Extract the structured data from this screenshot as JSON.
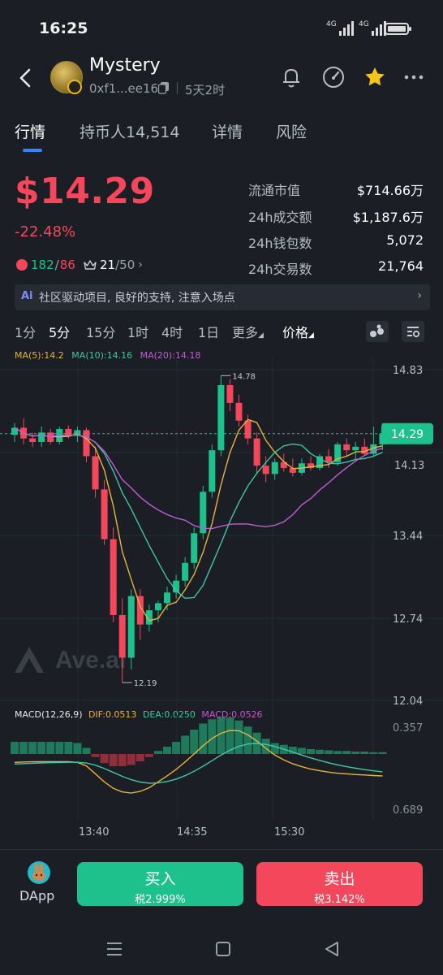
{
  "status": {
    "time": "16:25",
    "signal1": "4G",
    "signal2": "4G"
  },
  "token": {
    "name": "Mystery",
    "address": "0xf1...ee16",
    "age": "5天2时"
  },
  "tabs": [
    "行情",
    "持币人14,514",
    "详情",
    "风险"
  ],
  "price": {
    "value": "$14.29",
    "change": "-22.48%"
  },
  "badges": {
    "buy_count": "182",
    "sell_count": "86",
    "separator": "/",
    "holders_rank": "21",
    "holders_total": "/50"
  },
  "stats": [
    {
      "label": "流通市值",
      "value": "$714.66万"
    },
    {
      "label": "24h成交额",
      "value": "$1,187.6万"
    },
    {
      "label": "24h钱包数",
      "value": "5,072"
    },
    {
      "label": "24h交易数",
      "value": "21,764"
    }
  ],
  "notice": {
    "ai_label": "Ai",
    "text": "社区驱动项目, 良好的支持, 注意入场点"
  },
  "intervals": [
    "1分",
    "5分",
    "15分",
    "1时",
    "4时",
    "1日",
    "更多",
    "价格"
  ],
  "ma": {
    "ma5": "MA(5):14.2",
    "ma10": "MA(10):14.16",
    "ma20": "MA(20):14.18"
  },
  "macd": {
    "label": "MACD(12,26,9)",
    "dif": "DIF:0.0513",
    "dea": "DEA:0.0250",
    "macd": "MACD:0.0526"
  },
  "colors": {
    "up": "#1ec08c",
    "down": "#f5475c",
    "ma5": "#e8b43a",
    "ma10": "#3fc7a6",
    "ma20": "#c35ad6",
    "accent": "#3b82f6"
  },
  "chart_data": {
    "type": "candlestick",
    "y_ticks": [
      "14.83",
      "14.13",
      "13.44",
      "12.74",
      "12.04"
    ],
    "current_price": "14.29",
    "high_label": "14.78",
    "low_label": "12.19",
    "watermark": "Ave.ai",
    "macd_ticks": [
      "0.357",
      "0.689"
    ],
    "x_labels": [
      "13:40",
      "14:35",
      "15:30"
    ],
    "ylim": [
      12.04,
      14.83
    ],
    "candles": [
      {
        "o": 14.28,
        "h": 14.38,
        "l": 14.22,
        "c": 14.34
      },
      {
        "o": 14.34,
        "h": 14.42,
        "l": 14.2,
        "c": 14.25
      },
      {
        "o": 14.25,
        "h": 14.3,
        "l": 14.18,
        "c": 14.22
      },
      {
        "o": 14.22,
        "h": 14.35,
        "l": 14.18,
        "c": 14.3
      },
      {
        "o": 14.3,
        "h": 14.33,
        "l": 14.2,
        "c": 14.22
      },
      {
        "o": 14.22,
        "h": 14.35,
        "l": 14.2,
        "c": 14.33
      },
      {
        "o": 14.33,
        "h": 14.36,
        "l": 14.25,
        "c": 14.27
      },
      {
        "o": 14.27,
        "h": 14.35,
        "l": 14.22,
        "c": 14.32
      },
      {
        "o": 14.32,
        "h": 14.34,
        "l": 14.05,
        "c": 14.1
      },
      {
        "o": 14.1,
        "h": 14.18,
        "l": 13.75,
        "c": 13.82
      },
      {
        "o": 13.82,
        "h": 13.9,
        "l": 13.35,
        "c": 13.4
      },
      {
        "o": 13.4,
        "h": 13.5,
        "l": 12.7,
        "c": 12.76
      },
      {
        "o": 12.76,
        "h": 12.9,
        "l": 12.19,
        "c": 12.4
      },
      {
        "o": 12.4,
        "h": 12.98,
        "l": 12.3,
        "c": 12.92
      },
      {
        "o": 12.92,
        "h": 12.98,
        "l": 12.55,
        "c": 12.68
      },
      {
        "o": 12.68,
        "h": 12.85,
        "l": 12.62,
        "c": 12.8
      },
      {
        "o": 12.8,
        "h": 12.88,
        "l": 12.7,
        "c": 12.86
      },
      {
        "o": 12.86,
        "h": 13.0,
        "l": 12.8,
        "c": 12.95
      },
      {
        "o": 12.95,
        "h": 13.1,
        "l": 12.9,
        "c": 13.05
      },
      {
        "o": 13.05,
        "h": 13.25,
        "l": 13.0,
        "c": 13.2
      },
      {
        "o": 13.2,
        "h": 13.5,
        "l": 13.15,
        "c": 13.45
      },
      {
        "o": 13.45,
        "h": 13.85,
        "l": 13.4,
        "c": 13.8
      },
      {
        "o": 13.8,
        "h": 14.2,
        "l": 13.75,
        "c": 14.15
      },
      {
        "o": 14.15,
        "h": 14.78,
        "l": 14.1,
        "c": 14.7
      },
      {
        "o": 14.7,
        "h": 14.75,
        "l": 14.48,
        "c": 14.55
      },
      {
        "o": 14.55,
        "h": 14.62,
        "l": 14.35,
        "c": 14.4
      },
      {
        "o": 14.4,
        "h": 14.45,
        "l": 14.2,
        "c": 14.25
      },
      {
        "o": 14.25,
        "h": 14.3,
        "l": 13.95,
        "c": 14.02
      },
      {
        "o": 14.02,
        "h": 14.1,
        "l": 13.88,
        "c": 13.95
      },
      {
        "o": 13.95,
        "h": 14.08,
        "l": 13.9,
        "c": 14.05
      },
      {
        "o": 14.05,
        "h": 14.12,
        "l": 13.97,
        "c": 14.0
      },
      {
        "o": 14.0,
        "h": 14.08,
        "l": 13.93,
        "c": 13.96
      },
      {
        "o": 13.96,
        "h": 14.08,
        "l": 13.94,
        "c": 14.04
      },
      {
        "o": 14.04,
        "h": 14.1,
        "l": 13.98,
        "c": 14.0
      },
      {
        "o": 14.0,
        "h": 14.12,
        "l": 13.98,
        "c": 14.1
      },
      {
        "o": 14.1,
        "h": 14.16,
        "l": 14.0,
        "c": 14.05
      },
      {
        "o": 14.05,
        "h": 14.22,
        "l": 14.02,
        "c": 14.2
      },
      {
        "o": 14.2,
        "h": 14.25,
        "l": 14.1,
        "c": 14.15
      },
      {
        "o": 14.15,
        "h": 14.22,
        "l": 14.08,
        "c": 14.18
      },
      {
        "o": 14.18,
        "h": 14.25,
        "l": 14.1,
        "c": 14.12
      },
      {
        "o": 14.12,
        "h": 14.35,
        "l": 14.1,
        "c": 14.2
      },
      {
        "o": 14.2,
        "h": 14.38,
        "l": 14.15,
        "c": 14.29
      }
    ],
    "macd_hist": [
      0.2,
      0.2,
      0.2,
      0.2,
      0.2,
      0.2,
      0.2,
      0.18,
      0.1,
      -0.05,
      -0.15,
      -0.2,
      -0.2,
      -0.18,
      -0.12,
      -0.05,
      0.05,
      0.12,
      0.2,
      0.3,
      0.4,
      0.5,
      0.57,
      0.6,
      0.6,
      0.55,
      0.45,
      0.35,
      0.25,
      0.18,
      0.15,
      0.12,
      0.1,
      0.08,
      0.07,
      0.06,
      0.05,
      0.05,
      0.04,
      0.04,
      0.03,
      0.03
    ]
  },
  "actions": {
    "dapp": "DApp",
    "buy": "买入",
    "buy_tax": "税2.999%",
    "sell": "卖出",
    "sell_tax": "税3.142%"
  }
}
